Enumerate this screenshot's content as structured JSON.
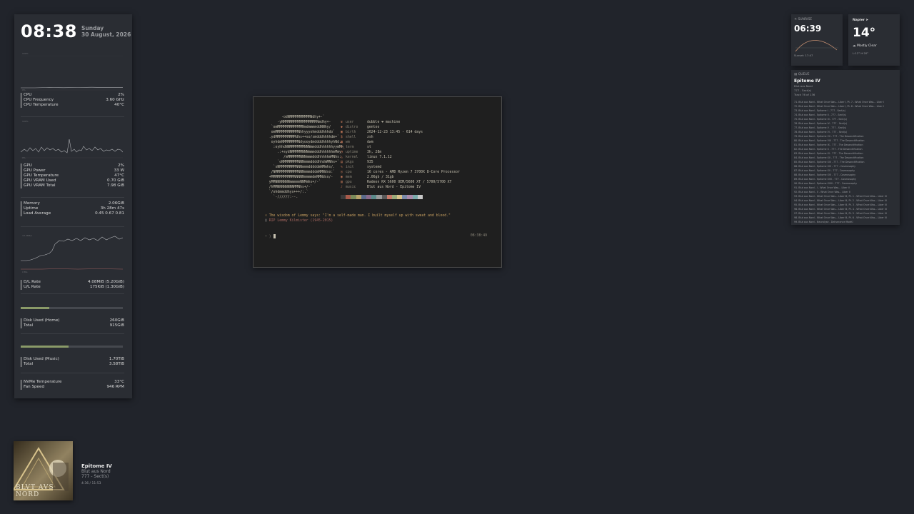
{
  "clock": {
    "time": "08:38",
    "day": "Sunday",
    "date": "30 August, 2026"
  },
  "graph_labels": {
    "cpu_top": "100%",
    "cpu_bottom": "0%",
    "gpu_top": "100%",
    "gpu_bottom": "0%",
    "net_top": "4.1 MiB/s",
    "net_bottom": "0 B/s"
  },
  "cpu": [
    {
      "label": "CPU",
      "value": "2%"
    },
    {
      "label": "CPU Frequency",
      "value": "3.60 GHz"
    },
    {
      "label": "CPU Temperature",
      "value": "40°C"
    }
  ],
  "gpu": [
    {
      "label": "GPU",
      "value": "2%"
    },
    {
      "label": "GPU Power",
      "value": "33 W"
    },
    {
      "label": "GPU Temperature",
      "value": "47°C"
    },
    {
      "label": "GPU VRAM Used",
      "value": "0.70 GiB"
    },
    {
      "label": "GPU VRAM Total",
      "value": "7.98 GiB"
    }
  ],
  "mem": [
    {
      "label": "Memory",
      "value": "2.06GiB"
    },
    {
      "label": "Uptime",
      "value": "3h 28m 47s"
    },
    {
      "label": "Load Average",
      "value": "0.45 0.67 0.81"
    }
  ],
  "net": [
    {
      "label": "D/L Rate",
      "value": "4.08MiB (5.20GiB)"
    },
    {
      "label": "U/L Rate",
      "value": "175KiB (1.30GiB)"
    }
  ],
  "disk_home": {
    "used_fraction": 0.28,
    "rows": [
      {
        "label": "Disk Used (Home)",
        "value": "260GiB"
      },
      {
        "label": "Total",
        "value": "915GiB"
      }
    ]
  },
  "disk_music": {
    "used_fraction": 0.47,
    "rows": [
      {
        "label": "Disk Used (Music)",
        "value": "1.70TiB"
      },
      {
        "label": "Total",
        "value": "3.58TiB"
      }
    ]
  },
  "nvme": [
    {
      "label": "NVMe Temperature",
      "value": "33°C"
    },
    {
      "label": "Fan Speed",
      "value": "946 RPM"
    }
  ],
  "now_playing": {
    "title": "Epitome IV",
    "artist": "Blut aus Nord",
    "album": "777 - Sect(s)",
    "time": "4:36 / 11:53",
    "art_text": "BLVT AVS NORD"
  },
  "terminal": {
    "ascii": [
      "        -odNMMMMMMMMMMNdhy+-`",
      "      -yNMMMMMMMMMMMMMMMMNmdhy+-",
      "   `omMMMMMMMMMMMMNmdmmmmddNNhy/",
      "   omMMMMMMMMMMMNhhyyyohmdddhhhdo`",
      "  .ydMMMMMMMMMMdhs++so/smdddhhhhdm+`",
      "   oyhdmNMMMMMMMNdyooydmddddhhhhyhNd.",
      "    :oyhhdNNMMMMMMMNNNmmdddhhhhhhyymMh",
      "      .:+sydNMMMMMNNNmmmdddhhhhhhmMmy",
      "         /mMMMMMMNNNmmmdddhhhhhmMNhs:",
      "      `oNMMMMMMMNNNmmmddddhhdmMNhs+`",
      "    `sNMMMMMMMMNNNmmmdddddmNMmhs/.",
      "   /NMMMMMMMMMMMNNNmmmdddmNMNdso:`",
      "  +MMMMMMMMMMMNNNNNmmmmdmNMNdso/-",
      "  yMMNNNNNNNmmmmmNNMmhs+/-`",
      "  /hMMNNNNNNNNMMNhs+/-`",
      "  `/ohdmmddhys+++/:.`",
      "    `-//////:--."
    ],
    "info": [
      {
        "icon": "♛",
        "key": "user",
        "value": "dubble ❤ machine"
      },
      {
        "icon": "◆",
        "key": "distro",
        "value": "gentoo"
      },
      {
        "icon": "▣",
        "key": "birth",
        "value": "2024-12-23 13:45 - 614 days"
      },
      {
        "icon": "$",
        "key": "shell",
        "value": "zsh"
      },
      {
        "icon": "▦",
        "key": "wm",
        "value": "dwm"
      },
      {
        "icon": ">_",
        "key": "term",
        "value": "st"
      },
      {
        "icon": "◔",
        "key": "uptime",
        "value": "3h, 28m"
      },
      {
        "icon": "◬",
        "key": "kernel",
        "value": "linux 7.1.12"
      },
      {
        "icon": "▤",
        "key": "pkgs",
        "value": "935"
      },
      {
        "icon": "✎",
        "key": "init",
        "value": "systemd"
      },
      {
        "icon": "◎",
        "key": "cpu",
        "value": "16 cores - AMD Ryzen 7 3700X 8-Core Processor"
      },
      {
        "icon": "◉",
        "key": "mem",
        "value": "2.06gb / 31gb"
      },
      {
        "icon": "▥",
        "key": "gpu",
        "value": "Radeon RX 5600 OEM/5600 XT / 5700/5700 XT"
      },
      {
        "icon": "♪",
        "key": "music",
        "value": "Blut aus Nord - Epitome IV"
      }
    ],
    "palette": [
      "#3a3a3a",
      "#a85a4a",
      "#7a8a5a",
      "#b8a26a",
      "#5a6a8a",
      "#8a6a8a",
      "#5a8a8a",
      "#9a9a9a",
      "#5a5a5a",
      "#c87a6a",
      "#9aaa7a",
      "#d8c28a",
      "#7a8aaa",
      "#aa8aaa",
      "#7aaaaa",
      "#c8c8c8"
    ],
    "quote": "The wisdom of Lemmy says: \"I'm a self-made man. I built myself up with sweat and blood.\"",
    "rip": "RIP Lemmy Kilmister (1945-2015)",
    "prompt": "~ )",
    "time": "08:38:49"
  },
  "sunrise": {
    "label": "SUNRISE",
    "time": "06:39",
    "sunset": "Sunset: 17:47"
  },
  "weather": {
    "location": "Napier",
    "temp": "14°",
    "condition": "Mostly Clear",
    "range": "L:12° H:20°"
  },
  "queue": {
    "label": "QUEUE",
    "title": "Epitome IV",
    "artist": "Blut aus Nord",
    "album": "777 - Sect(s)",
    "track": "Track 76 of 136",
    "items": [
      "71. Blut aus Nord - What Once Was... Liber I, Pt. 7 - What Once Was... Liber I",
      "72. Blut aus Nord - What Once Was... Liber I, Pt. 8 - What Once Was... Liber I",
      "73. Blut aus Nord - Epitome I - 777 - Sect(s)",
      "74. Blut aus Nord - Epitome II - 777 - Sect(s)",
      "75. Blut aus Nord - Epitome III - 777 - Sect(s)",
      "76. Blut aus Nord - Epitome IV - 777 - Sect(s)",
      "77. Blut aus Nord - Epitome V - 777 - Sect(s)",
      "78. Blut aus Nord - Epitome VI - 777 - Sect(s)",
      "79. Blut aus Nord - Epitome VII - 777 - The Desanctification",
      "80. Blut aus Nord - Epitome VIII - 777 - The Desanctification",
      "81. Blut aus Nord - Epitome IX - 777 - The Desanctification",
      "82. Blut aus Nord - Epitome X - 777 - The Desanctification",
      "83. Blut aus Nord - Epitome XI - 777 - The Desanctification",
      "84. Blut aus Nord - Epitome XII - 777 - The Desanctification",
      "85. Blut aus Nord - Epitome XIII - 777 - The Desanctification",
      "86. Blut aus Nord - Epitome XIV - 777 - Cosmosophy",
      "87. Blut aus Nord - Epitome XV - 777 - Cosmosophy",
      "88. Blut aus Nord - Epitome XVI - 777 - Cosmosophy",
      "89. Blut aus Nord - Epitome XVII - 777 - Cosmosophy",
      "90. Blut aus Nord - Epitome XVIII - 777 - Cosmosophy",
      "91. Blut aus Nord - I - What Once Was... Liber II",
      "92. Blut aus Nord - II - What Once Was... Liber II",
      "93. Blut aus Nord - What Once Was... Liber III, Pt. 1 - What Once Was... Liber III",
      "94. Blut aus Nord - What Once Was... Liber III, Pt. 2 - What Once Was... Liber III",
      "95. Blut aus Nord - What Once Was... Liber III, Pt. 3 - What Once Was... Liber III",
      "96. Blut aus Nord - What Once Was... Liber III, Pt. 4 - What Once Was... Liber III",
      "97. Blut aus Nord - What Once Was... Liber III, Pt. 5 - What Once Was... Liber III",
      "98. Blut aus Nord - What Once Was... Liber III, Pt. 6 - What Once Was... Liber III",
      "99. Blut aus Nord - Neuralyse - Deliverance MoeKi"
    ]
  }
}
